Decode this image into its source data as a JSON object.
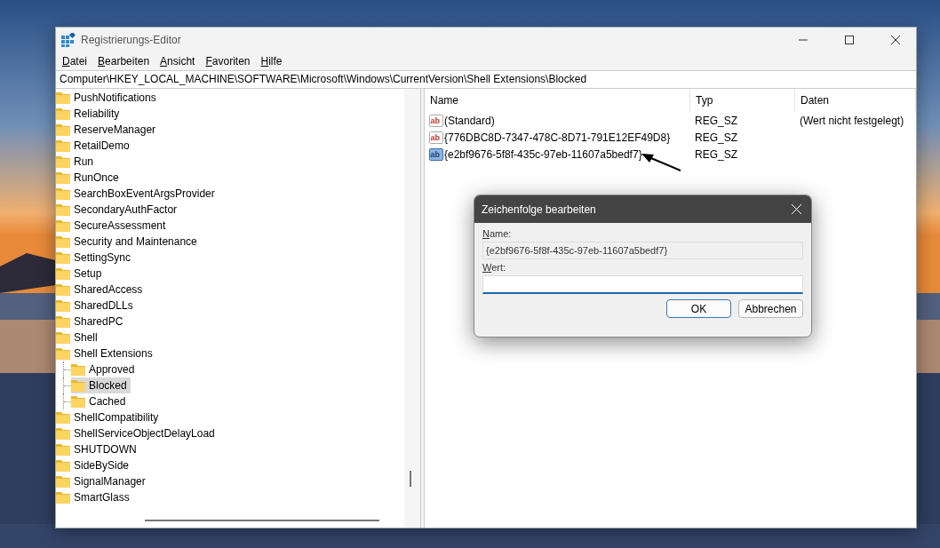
{
  "window": {
    "title": "Registrierungs-Editor"
  },
  "menu": [
    "Datei",
    "Bearbeiten",
    "Ansicht",
    "Favoriten",
    "Hilfe"
  ],
  "address": "Computer\\HKEY_LOCAL_MACHINE\\SOFTWARE\\Microsoft\\Windows\\CurrentVersion\\Shell Extensions\\Blocked",
  "tree": [
    {
      "label": "PushNotifications",
      "selected": false
    },
    {
      "label": "Reliability",
      "selected": false
    },
    {
      "label": "ReserveManager",
      "selected": false
    },
    {
      "label": "RetailDemo",
      "selected": false
    },
    {
      "label": "Run",
      "selected": false
    },
    {
      "label": "RunOnce",
      "selected": false
    },
    {
      "label": "SearchBoxEventArgsProvider",
      "selected": false
    },
    {
      "label": "SecondaryAuthFactor",
      "selected": false
    },
    {
      "label": "SecureAssessment",
      "selected": false
    },
    {
      "label": "Security and Maintenance",
      "selected": false
    },
    {
      "label": "SettingSync",
      "selected": false
    },
    {
      "label": "Setup",
      "selected": false
    },
    {
      "label": "SharedAccess",
      "selected": false
    },
    {
      "label": "SharedDLLs",
      "selected": false
    },
    {
      "label": "SharedPC",
      "selected": false
    },
    {
      "label": "Shell",
      "selected": false
    },
    {
      "label": "Shell Extensions",
      "selected": false,
      "children": [
        {
          "label": "Approved",
          "selected": false
        },
        {
          "label": "Blocked",
          "selected": true
        },
        {
          "label": "Cached",
          "selected": false
        }
      ]
    },
    {
      "label": "ShellCompatibility",
      "selected": false
    },
    {
      "label": "ShellServiceObjectDelayLoad",
      "selected": false
    },
    {
      "label": "SHUTDOWN",
      "selected": false
    },
    {
      "label": "SideBySide",
      "selected": false
    },
    {
      "label": "SignalManager",
      "selected": false
    },
    {
      "label": "SmartGlass",
      "selected": false
    }
  ],
  "values": {
    "columns": [
      "Name",
      "Typ",
      "Daten"
    ],
    "rows": [
      {
        "icon": "ab",
        "name": "(Standard)",
        "type": "REG_SZ",
        "data": "(Wert nicht festgelegt)",
        "selected": false
      },
      {
        "icon": "ab",
        "name": "{776DBC8D-7347-478C-8D71-791E12EF49D8}",
        "type": "REG_SZ",
        "selected": false
      },
      {
        "icon": "ab",
        "name": "{e2bf9676-5f8f-435c-97eb-11607a5bedf7}",
        "type": "REG_SZ",
        "selected": true
      }
    ]
  },
  "dialog": {
    "title": "Zeichenfolge bearbeiten",
    "name_label": "Name:",
    "name_value": "{e2bf9676-5f8f-435c-97eb-11607a5bedf7}",
    "value_label": "Wert:",
    "buttons": [
      "OK",
      "Abbrechen"
    ]
  }
}
